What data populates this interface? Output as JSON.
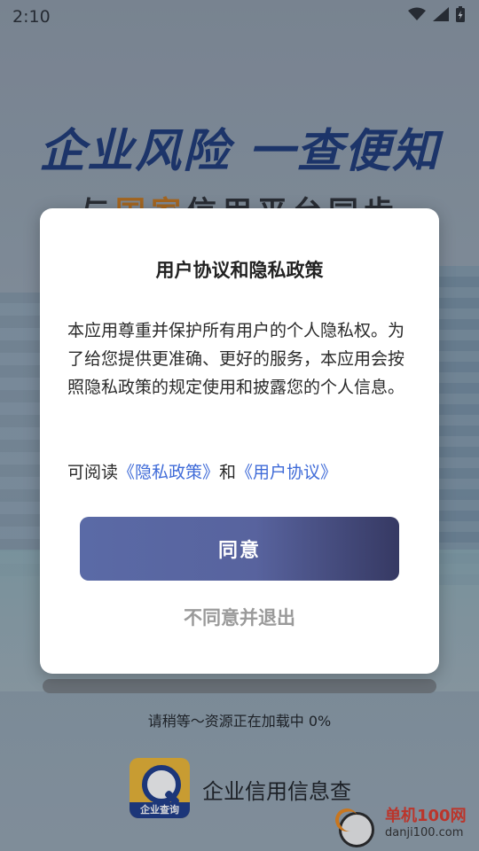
{
  "status_bar": {
    "time": "2:10"
  },
  "splash": {
    "slogan": "企业风险 一查便知",
    "sub_slogan_part1": "与",
    "sub_slogan_accent": "国家",
    "sub_slogan_part2": "信用平台同步",
    "loading_text": "请稍等～资源正在加载中 0%",
    "loading_progress": 0,
    "app_logo_label": "企业查询",
    "app_name": "企业信用信息查"
  },
  "watermark": {
    "title": "单机100网",
    "url": "danji100.com"
  },
  "dialog": {
    "title": "用户协议和隐私政策",
    "body": "本应用尊重并保护所有用户的个人隐私权。为了给您提供更准确、更好的服务，本应用会按照隐私政策的规定使用和披露您的个人信息。",
    "links_prefix": "可阅读",
    "privacy_link": "《隐私政策》",
    "links_and": "和",
    "agreement_link": "《用户协议》",
    "agree_label": "同意",
    "decline_label": "不同意并退出"
  },
  "colors": {
    "accent_button": "#58639e",
    "link": "#3f6bd8",
    "slogan": "#1e3a78",
    "sub_slogan_accent": "#c2761f"
  }
}
